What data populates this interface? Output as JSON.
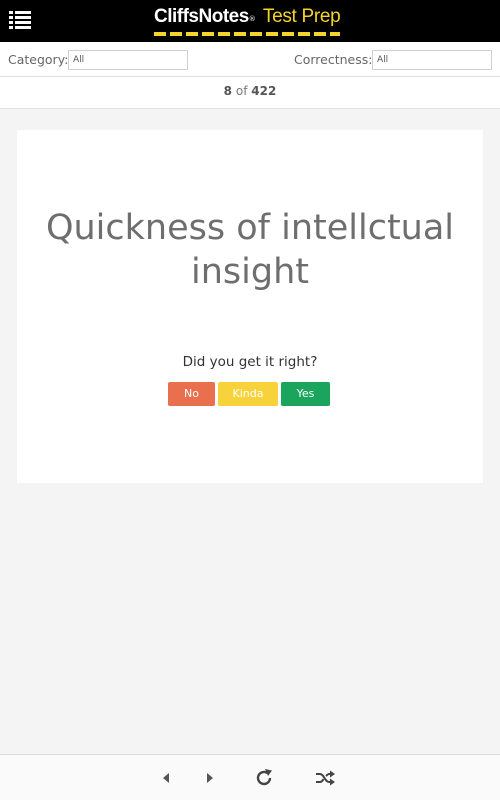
{
  "header": {
    "brand": "CliffsNotes",
    "registered": "®",
    "product": "Test Prep",
    "colors": {
      "background": "#000000",
      "accent": "#f5d52b"
    },
    "menu_icon": "list-menu-icon"
  },
  "filters": {
    "category_label": "Category:",
    "category_value": "All",
    "correctness_label": "Correctness:",
    "correctness_value": "All"
  },
  "counter": {
    "current": "8",
    "separator": "of",
    "total": "422"
  },
  "card": {
    "term": "Quickness of intellctual insight",
    "prompt": "Did you get it right?",
    "buttons": {
      "no": "No",
      "kinda": "Kinda",
      "yes": "Yes"
    },
    "colors": {
      "no": "#e9704f",
      "kinda": "#f7d23a",
      "yes": "#1aa45c"
    }
  },
  "toolbar": {
    "icons": [
      "previous-icon",
      "next-icon",
      "reload-icon",
      "shuffle-icon"
    ]
  }
}
